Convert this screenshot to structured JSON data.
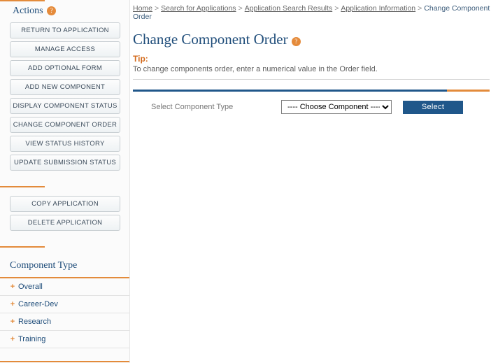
{
  "breadcrumbs": {
    "items": [
      {
        "label": "Home"
      },
      {
        "label": "Search for Applications"
      },
      {
        "label": "Application Search Results"
      },
      {
        "label": "Application Information"
      }
    ],
    "current": "Change Component Order"
  },
  "page": {
    "title": "Change Component Order",
    "tip_label": "Tip:",
    "tip_text": "To change components order, enter a numerical value in the Order field."
  },
  "form": {
    "label": "Select Component Type",
    "dropdown_placeholder": "---- Choose Component ----",
    "select_button": "Select"
  },
  "sidebar": {
    "actions_heading": "Actions",
    "component_type_heading": "Component Type",
    "action_buttons": [
      "RETURN TO APPLICATION",
      "MANAGE ACCESS",
      "ADD OPTIONAL FORM",
      "ADD NEW COMPONENT",
      "DISPLAY COMPONENT STATUS",
      "CHANGE COMPONENT ORDER",
      "VIEW STATUS HISTORY",
      "UPDATE SUBMISSION STATUS"
    ],
    "management_buttons": [
      "COPY APPLICATION",
      "DELETE APPLICATION"
    ],
    "component_types": [
      "Overall",
      "Career-Dev",
      "Research",
      "Training"
    ]
  },
  "colors": {
    "orange": "#e38b3b",
    "blue": "#1f4d7a",
    "btn_blue": "#20578a"
  }
}
